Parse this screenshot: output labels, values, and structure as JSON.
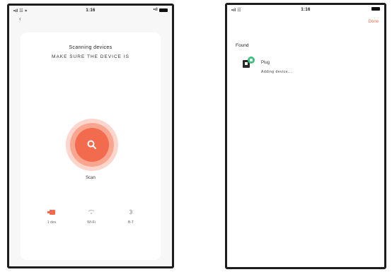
{
  "left_phone": {
    "status": {
      "carrier": "•ıl ☷ ≈",
      "time": "1:16",
      "signal": "•ıl"
    },
    "back_icon": "back-chevron-icon",
    "title": "Scanning devices",
    "subtitle": "MAKE SURE THE DEVICE IS",
    "scan_icon": "search-icon",
    "scan_label": "Scan",
    "options": [
      {
        "icon": "device-icon",
        "label": "1 dev"
      },
      {
        "icon": "wifi-icon",
        "label": "Wi-Fi"
      },
      {
        "icon": "bluetooth-icon",
        "label": "B-T"
      }
    ]
  },
  "right_phone": {
    "status": {
      "carrier": "•ıl ☷",
      "time": "1:16",
      "signal": ""
    },
    "cancel_label": "Done",
    "found_label": "Found",
    "device": {
      "icon": "plug-device-icon",
      "name": "Plug",
      "status": "Adding device..."
    }
  },
  "colors": {
    "accent": "#f26b4e",
    "accent_light": "#fcd6cc",
    "accent_mid": "#f8a690",
    "frame": "#1c1c1c",
    "device_green": "#39c27a"
  }
}
